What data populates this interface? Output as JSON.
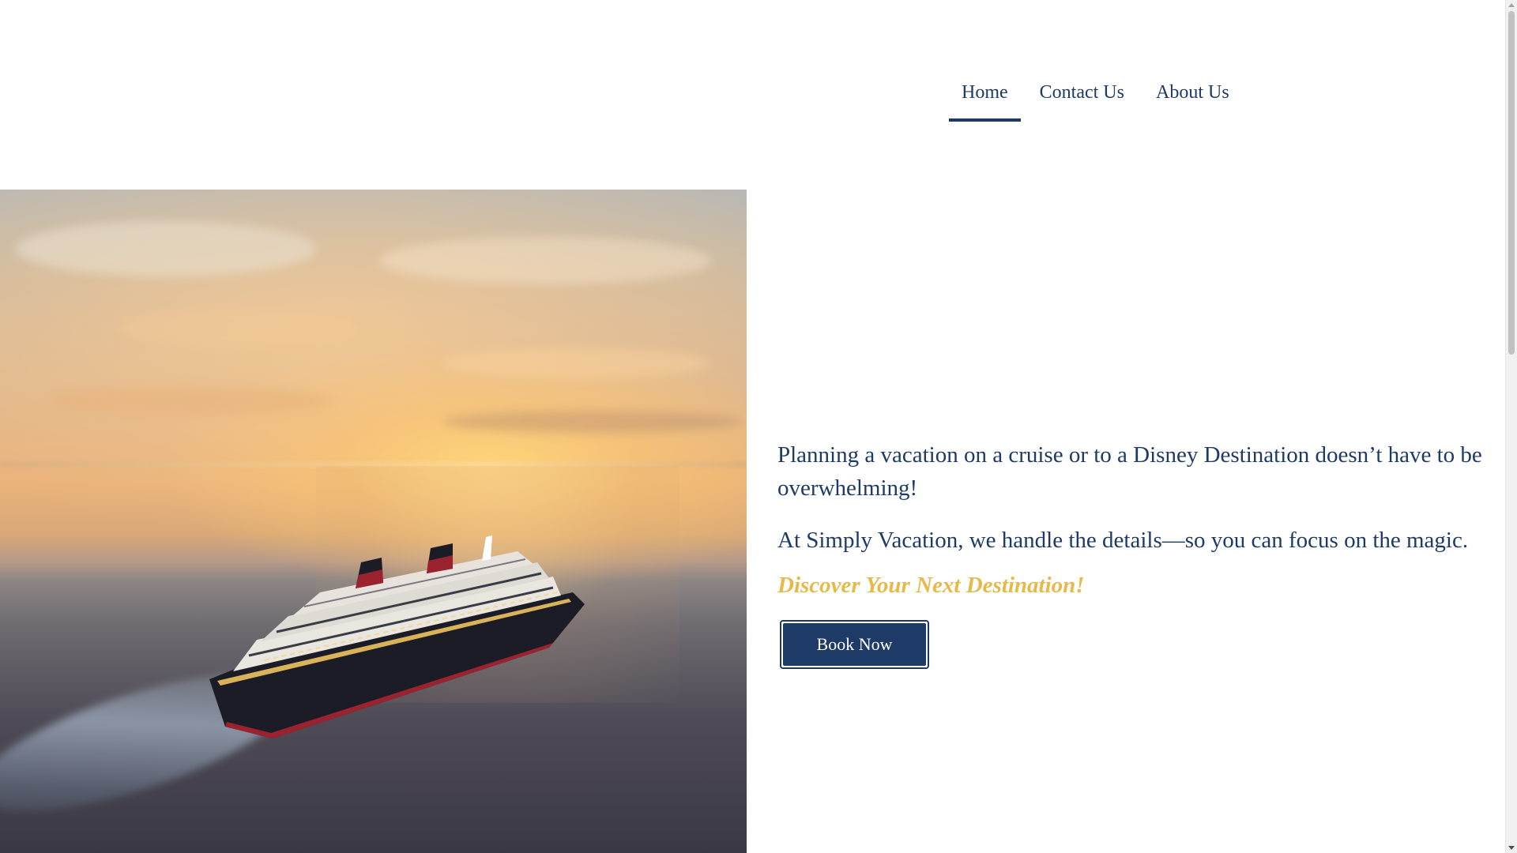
{
  "nav": {
    "items": [
      {
        "label": "Home",
        "active": true
      },
      {
        "label": "Contact Us",
        "active": false
      },
      {
        "label": "About Us",
        "active": false
      }
    ]
  },
  "hero": {
    "image": "cruise-ship-at-sunset"
  },
  "content": {
    "lead": "Planning a vacation on a cruise or to a Disney Destination doesn’t have to be overwhelming!",
    "tagline": "At Simply Vacation, we handle the details—so you can focus on the magic.",
    "cta_heading": "Discover Your Next Destination!",
    "button_label": "Book Now"
  },
  "colors": {
    "brand_navy": "#1e3a66",
    "accent_gold": "#e6b949",
    "background": "#ffffff"
  }
}
